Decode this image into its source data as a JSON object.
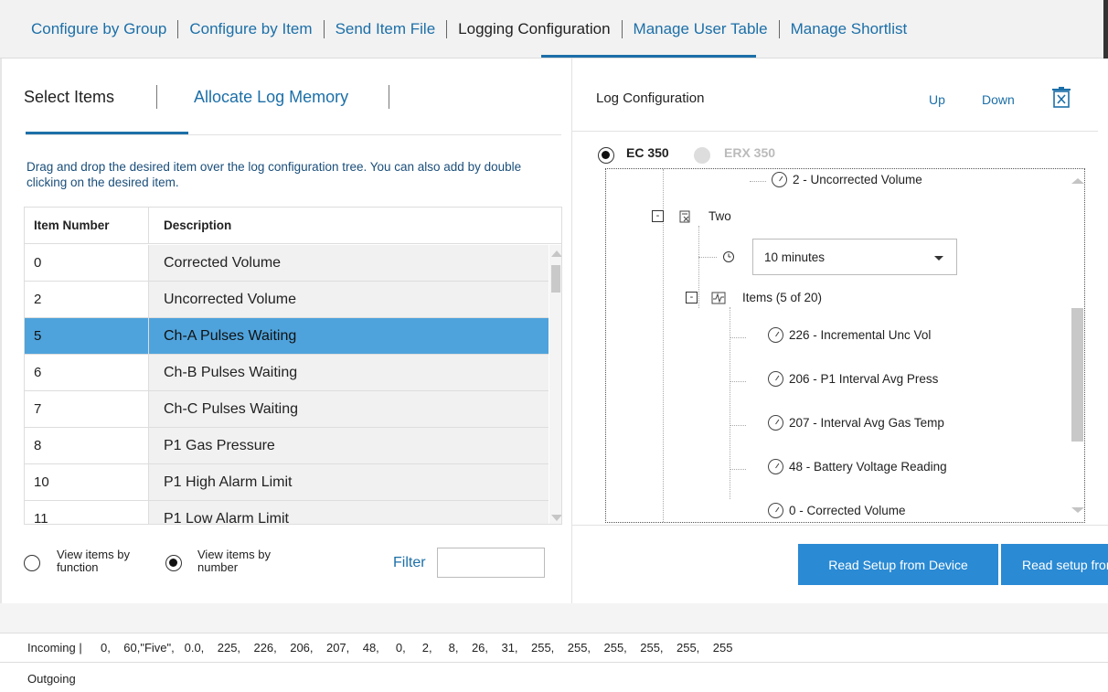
{
  "topnav": {
    "tabs": [
      "Configure by Group",
      "Configure by Item",
      "Send Item File",
      "Logging Configuration",
      "Manage User Table",
      "Manage Shortlist"
    ],
    "active_tab": "Logging Configuration"
  },
  "left": {
    "subtabs": [
      "Select Items",
      "Allocate Log Memory"
    ],
    "instruction": "Drag and drop the desired item over the log configuration tree. You can also add by double clicking on the desired item.",
    "table": {
      "headers": [
        "Item Number",
        "Description"
      ],
      "rows": [
        {
          "num": "0",
          "desc": "Corrected Volume"
        },
        {
          "num": "2",
          "desc": "Uncorrected Volume"
        },
        {
          "num": "5",
          "desc": "Ch-A Pulses Waiting"
        },
        {
          "num": "6",
          "desc": "Ch-B Pulses Waiting"
        },
        {
          "num": "7",
          "desc": "Ch-C Pulses Waiting"
        },
        {
          "num": "8",
          "desc": "P1 Gas Pressure"
        },
        {
          "num": "10",
          "desc": "P1 High Alarm Limit"
        },
        {
          "num": "11",
          "desc": "P1 Low Alarm Limit"
        }
      ],
      "selected_row": "5"
    },
    "view_by_function": "View items by function",
    "view_by_number": "View items by number",
    "view_selected": "number",
    "filter_label": "Filter",
    "filter_value": ""
  },
  "right": {
    "title": "Log Configuration",
    "up_label": "Up",
    "down_label": "Down",
    "devices": [
      "EC 350",
      "ERX 350"
    ],
    "device_selected": "EC 350",
    "tree": {
      "top_item": "2 - Uncorrected Volume",
      "group": "Two",
      "interval": "10 minutes",
      "items_label": "Items (5 of 20)",
      "items": [
        "226 - Incremental Unc Vol",
        "206 - P1 Interval Avg Press",
        "207 - Interval Avg Gas Temp",
        "48 - Battery Voltage Reading",
        "0 - Corrected Volume"
      ]
    },
    "buttons": [
      "Read Setup from Device",
      "Read setup from file"
    ]
  },
  "log": {
    "incoming_label": "Incoming |",
    "incoming_data": "0,    60,\"Five\",   0.0,    225,    226,    206,    207,    48,     0,     2,     8,    26,    31,    255,    255,    255,    255,    255,    255",
    "outgoing_label": "Outgoing"
  }
}
